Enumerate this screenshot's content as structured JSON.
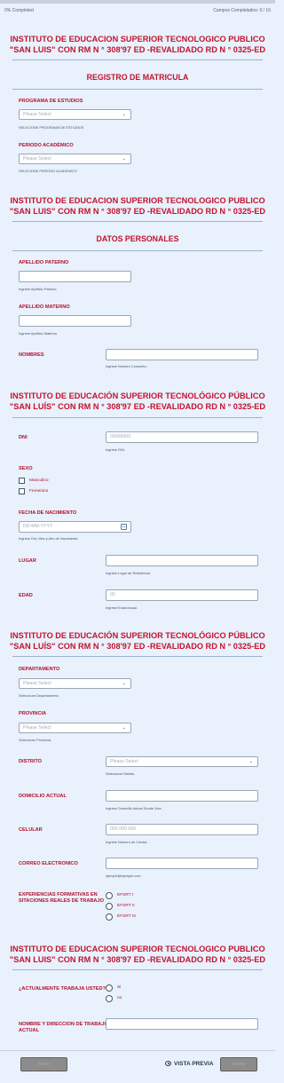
{
  "progress": {
    "completed_text": "0% Completed",
    "fields_text": "Campos Completados: 0 / 16",
    "fraction": 0
  },
  "institute": {
    "line1_plain": "INSTITUTO DE EDUCACION SUPERIOR TECNOLOGICO PUBLICO",
    "line2_plain": "\"SAN LUIS\" CON RM N ° 308'97 ED -REVALIDADO RD N ° 0325-ED",
    "line1_accent": "INSTITUTO DE EDUCACIÓN SUPERIOR TECNOLÓGICO PÚBLICO",
    "line2_accent": "\"SAN LUÍS\" CON RM N ° 308'97 ED -REVALIDADO RD N ° 0325-ED"
  },
  "sections": {
    "registro": "REGISTRO DE MATRICULA",
    "datos": "DATOS PERSONALES"
  },
  "fields": {
    "programa": {
      "label": "PROGRAMA DE ESTUDIOS",
      "placeholder": "Please Select",
      "help": "SELECIONE PROGRAMA DE ESTUDIOS"
    },
    "periodo": {
      "label": "PERIODO ACADÉMICO",
      "placeholder": "Please Select",
      "help": "SELECIONE PERIODO ACADÉMICO"
    },
    "ap_paterno": {
      "label": "APELLIDO PATERNO",
      "help": "Ingrese Apellido Paterno."
    },
    "ap_materno": {
      "label": "APELLIDO MATERNO",
      "help": "Ingrese Apellido Materno."
    },
    "nombres": {
      "label": "NOMBRES",
      "help": "Ingrese Nombre Completo."
    },
    "dni": {
      "label": "DNI",
      "placeholder": "00000000",
      "help": "Ingrese DNI."
    },
    "sexo": {
      "label": "SEXO",
      "options": [
        "Masculino",
        "Femenino"
      ]
    },
    "fecha": {
      "label": "FECHA DE NACIMIENTO",
      "placeholder": "DD-MM-YYYY",
      "help": "Ingrese Día, Mes y Año de Nacimiento."
    },
    "lugar": {
      "label": "LUGAR",
      "help": "Ingrese Lugar de Residencia."
    },
    "edad": {
      "label": "EDAD",
      "placeholder": "00",
      "help": "Ingrese Edad Actual."
    },
    "departamento": {
      "label": "DEPARTAMENTO",
      "placeholder": "Please Select",
      "help": "Seleccione Departamento."
    },
    "provincia": {
      "label": "PROVINCIA",
      "placeholder": "Please Select",
      "help": "Seleccione Provincia."
    },
    "distrito": {
      "label": "DISTRITO",
      "placeholder": "Please Select",
      "help": "Seleccione Distrito."
    },
    "domicilio": {
      "label": "DOMICILIO ACTUAL",
      "help": "Ingrese Domicilio Actual Donde Vive."
    },
    "celular": {
      "label": "CELULAR",
      "placeholder": "000 000 000",
      "help": "Ingrese Número de Celular."
    },
    "correo": {
      "label": "CORREO ELECTRONICO",
      "help": "ejemplo@ejemplo.com"
    },
    "experiencias": {
      "label_line1": "EXPERIENCIAS FORMATIVAS EN",
      "label_line2": "SITACIONES REALES DE TRABAJO",
      "options": [
        "EFSRT I",
        "EFSRT II",
        "EFSRT III"
      ]
    },
    "trabaja": {
      "label": "¿ACTUALMENTE TRABAJA USTED?",
      "options": [
        "Si",
        "no"
      ]
    },
    "trabajo_nombre": {
      "label_line1": "NOMBRE Y DIRECCION DE TRABAJO",
      "label_line2": "ACTUAL"
    }
  },
  "buttons": {
    "back": "Atrás",
    "preview": "VISTA PREVIA",
    "submit": "Enviar"
  }
}
